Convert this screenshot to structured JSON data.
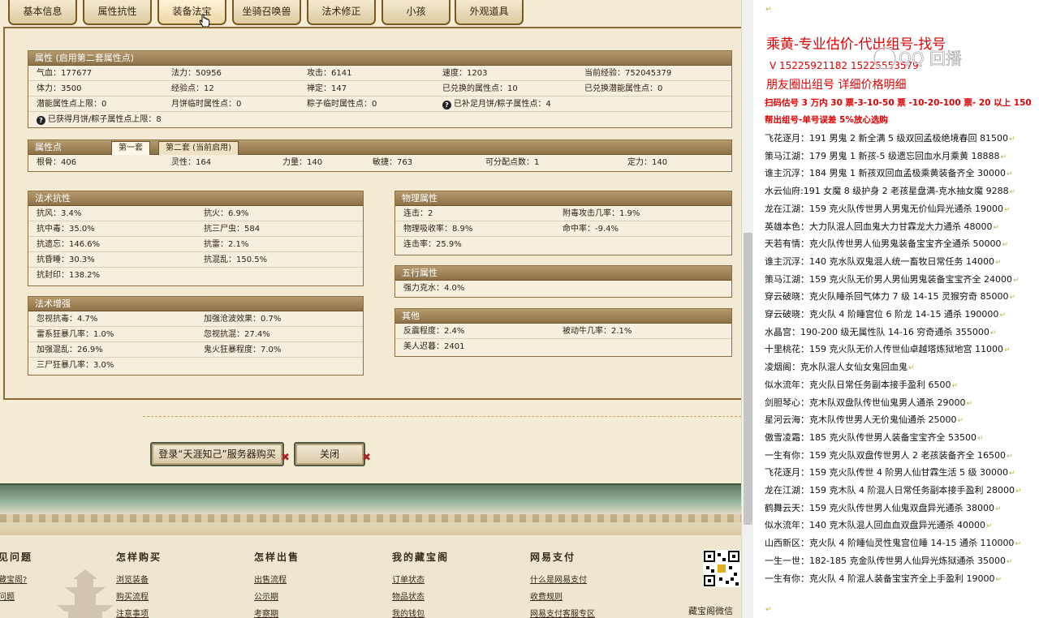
{
  "tabs": [
    "基本信息",
    "属性抗性",
    "装备法宝",
    "坐骑召唤兽",
    "法术修正",
    "小孩",
    "外观道具"
  ],
  "active_tab_index": 2,
  "attr_section": {
    "title": "属性 (启用第二套属性点)",
    "rows": [
      [
        "气血：177677",
        "法力：50956",
        "攻击：6141",
        "速度：1203",
        "当前经验：752045379"
      ],
      [
        "体力：3500",
        "经验点：12",
        "禅定：147",
        "已兑换的属性点：10",
        "已兑换潜能属性点：0"
      ],
      [
        "潜能属性点上限：0",
        "月饼临时属性点：0",
        "粽子临时属性点：0",
        "已补足月饼/粽子属性点：4",
        ""
      ],
      [
        "已获得月饼/粽子属性点上限：8",
        "",
        "",
        "",
        ""
      ]
    ]
  },
  "points_section": {
    "title": "属性点",
    "subtabs": [
      "第一套",
      "第二套 (当前启用)"
    ],
    "row": [
      "根骨：406",
      "灵性：164",
      "力量：140",
      "敏捷：763",
      "可分配点数：1",
      "定力：140"
    ]
  },
  "spell_resist": {
    "title": "法术抗性",
    "rows": [
      [
        "抗风：3.4%",
        "抗火：6.9%"
      ],
      [
        "抗中毒：35.0%",
        "抗三尸虫：584"
      ],
      [
        "抗遗忘：146.6%",
        "抗雷：2.1%"
      ],
      [
        "抗昏睡：30.3%",
        "抗混乱：150.5%"
      ],
      [
        "抗封印：138.2%",
        ""
      ]
    ]
  },
  "physical": {
    "title": "物理属性",
    "rows": [
      [
        "连击：2",
        "附毒攻击几率：1.9%"
      ],
      [
        "物理吸收率：8.9%",
        "命中率：-9.4%"
      ],
      [
        "连击率：25.9%",
        ""
      ]
    ]
  },
  "spell_boost": {
    "title": "法术增强",
    "rows": [
      [
        "忽视抗毒：4.7%",
        "加强沧波效果：0.7%"
      ],
      [
        "雷系狂暴几率：1.0%",
        "忽视抗混：27.4%"
      ],
      [
        "加强混乱：26.9%",
        "鬼火狂暴程度：7.0%"
      ],
      [
        "三尸狂暴几率：3.0%",
        ""
      ]
    ]
  },
  "wuxing": {
    "title": "五行属性",
    "rows": [
      [
        "强力克水：4.0%",
        ""
      ]
    ]
  },
  "other": {
    "title": "其他",
    "rows": [
      [
        "反震程度：2.4%",
        "被动牛几率：2.1%"
      ],
      [
        "美人迟暮：2401",
        ""
      ]
    ]
  },
  "buttons": {
    "login": "登录“天涯知己”服务器购买",
    "close": "关闭"
  },
  "footer": {
    "cols": [
      {
        "title": "见问题",
        "links": [
          "藏宝阁?",
          "问题"
        ]
      },
      {
        "title": "怎样购买",
        "links": [
          "浏览装备",
          "购买流程",
          "注意事项"
        ]
      },
      {
        "title": "怎样出售",
        "links": [
          "出售流程",
          "公示期",
          "考察期"
        ]
      },
      {
        "title": "我的藏宝阁",
        "links": [
          "订单状态",
          "物品状态",
          "我的钱包"
        ]
      },
      {
        "title": "网易支付",
        "links": [
          "什么是网易支付",
          "收费规则",
          "网易支付客服专区"
        ]
      }
    ],
    "qr_label": "藏宝阁微信"
  },
  "doc": {
    "title": "乘黄-专业估价-代出组号-找号",
    "phone": "V 15225921182   15225553579",
    "friends": "朋友圈出组号    详细价格明细",
    "price_line": "扫码估号 3 万内 30 票-3-10-50 票  -10-20-100 票- 20 以上 150",
    "sell_line": "帮出组号-单号误差 5%放心选购",
    "watermark": "QQ 回播",
    "items": [
      "飞花逐月：191 男鬼 2 新全满 5 级双回孟极绝境春回 81500",
      "策马江湖：179 男鬼 1 新孩-5 级遗忘回血水月乘黄 18888",
      "谁主沉浮：184 男鬼 1 新孩双回血孟极乘黄装备齐全 30000",
      "水云仙府:191 女魔 8 级护身 2 老孩星盘满-克水抽女魔 9288",
      "龙在江湖：159 克火队传世男人男鬼无价仙异光通杀 19000",
      "英雄本色：大力队混人回血鬼大力甘霖龙大力通杀 48000",
      "天若有情：克火队传世男人仙男鬼装备宝宝齐全通杀 50000",
      "谁主沉浮：140 克水队双鬼混人统一畜牧日常任务 14000",
      "策马江湖：159 克火队无价男人男仙男鬼装备宝宝齐全 24000",
      "穿云破晓：克火队睡杀回气体力 7 级 14-15 灵猴穷奇 85000",
      "穿云破晓：克火队 4 阶睡宫位 6 阶龙 14-15 通杀 190000",
      "水晶宫：190-200 级无属性队 14-16 穷奇通杀 355000",
      "十里桃花：159 克火队无价人传世仙卓越塔炼狱地宫 11000",
      "凌烟阁：克水队混人女仙女鬼回血鬼",
      "似水流年：克火队日常任务副本接手盈利 6500",
      "剑胆琴心：克木队双盘队传世仙鬼男人通杀 29000",
      "星河云海：克木队传世男人无价鬼仙通杀 25000",
      "傲雪凌霜：185 克火队传世男人装备宝宝齐全 53500",
      "一生有你：159 克火队双盘传世男人 2 老孩装备齐全 16500",
      "飞花逐月：159 克火队传世 4 阶男人仙甘霖生活 5 级 30000",
      "龙在江湖：159 克木队 4 阶混人日常任务副本接手盈利 28000",
      "鹤舞云天：159 克火队传世男人仙鬼双盘异光通杀 38000",
      "似水流年：140 克木队混人回血血双盘异光通杀 40000",
      "山西新区：克火队 4 阶睡仙灵性鬼宫位睡 14-15 通杀 110000",
      "一生一世：182-185 克金队传世男人仙异光炼狱通杀 35000",
      "一生有你：克火队 4 阶混人装备宝宝齐全上手盈利 19000"
    ]
  }
}
